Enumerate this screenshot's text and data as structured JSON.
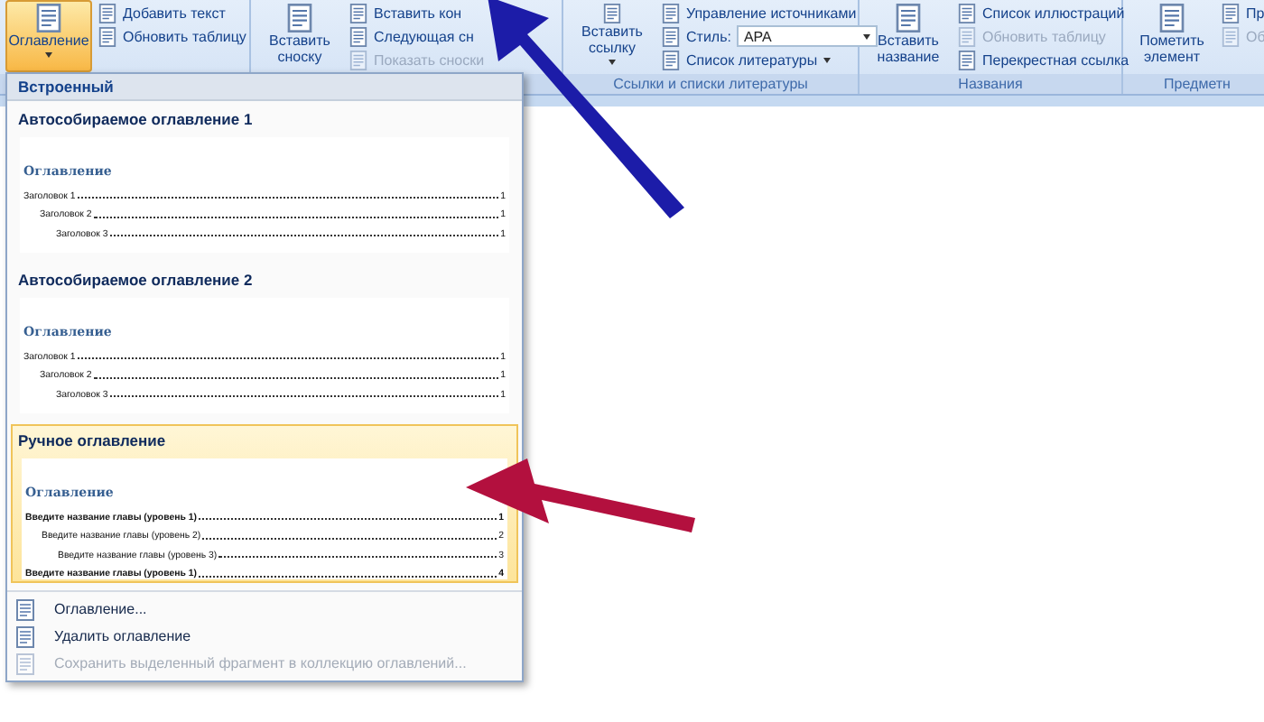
{
  "ribbon": {
    "groups": [
      {
        "large": [
          {
            "label": "Оглавление",
            "selected": true,
            "has_menu": true
          }
        ],
        "small": [
          {
            "kind": "button",
            "label": "Добавить текст",
            "disabled": false,
            "has_menu": false
          },
          {
            "kind": "button",
            "label": "Обновить таблицу",
            "disabled": false,
            "has_menu": false
          }
        ]
      },
      {
        "large": [
          {
            "label": "Вставить сноску",
            "selected": false,
            "has_menu": false
          }
        ],
        "small": [
          {
            "kind": "button",
            "label": "Вставить кон",
            "disabled": false,
            "has_menu": false
          },
          {
            "kind": "button",
            "label": "Следующая сн",
            "disabled": false,
            "has_menu": false
          },
          {
            "kind": "button",
            "label": "Показать сноски",
            "disabled": true,
            "has_menu": false
          }
        ]
      },
      {
        "label": "Ссылки и списки литературы",
        "large": [
          {
            "label": "Вставить ссылку",
            "selected": false,
            "has_menu": true
          }
        ],
        "small": [
          {
            "kind": "button",
            "label": "Управление источниками",
            "disabled": false,
            "has_menu": false
          },
          {
            "kind": "combo",
            "label": "Стиль:",
            "value": "APA"
          },
          {
            "kind": "button",
            "label": "Список литературы",
            "disabled": false,
            "has_menu": true
          }
        ]
      },
      {
        "label": "Названия",
        "large": [
          {
            "label": "Вставить название",
            "selected": false,
            "has_menu": false
          }
        ],
        "small": [
          {
            "kind": "button",
            "label": "Список иллюстраций",
            "disabled": false,
            "has_menu": false
          },
          {
            "kind": "button",
            "label": "Обновить таблицу",
            "disabled": true,
            "has_menu": false
          },
          {
            "kind": "button",
            "label": "Перекрестная ссылка",
            "disabled": false,
            "has_menu": false
          }
        ]
      },
      {
        "label": "Предметн",
        "large": [
          {
            "label": "Пометить элемент",
            "selected": false,
            "has_menu": false
          }
        ],
        "small": [
          {
            "kind": "button",
            "label": "Пр",
            "disabled": false
          },
          {
            "kind": "button",
            "label": "Об",
            "disabled": true
          }
        ]
      }
    ]
  },
  "toc_menu": {
    "header": "Встроенный",
    "items": [
      {
        "title": "Автособираемое оглавление 1",
        "selected": false,
        "heading": "Оглавление",
        "entries": [
          {
            "text": "Заголовок 1",
            "page": "1",
            "bold": false,
            "children": [
              {
                "text": "Заголовок 2",
                "page": "1",
                "bold": false,
                "children": [
                  {
                    "text": "Заголовок 3",
                    "page": "1",
                    "bold": false
                  }
                ]
              }
            ]
          }
        ]
      },
      {
        "title": "Автособираемое оглавление 2",
        "selected": false,
        "heading": "Оглавление",
        "entries": [
          {
            "text": "Заголовок 1",
            "page": "1",
            "bold": false,
            "children": [
              {
                "text": "Заголовок 2",
                "page": "1",
                "bold": false,
                "children": [
                  {
                    "text": "Заголовок 3",
                    "page": "1",
                    "bold": false
                  }
                ]
              }
            ]
          }
        ]
      },
      {
        "title": "Ручное оглавление",
        "selected": true,
        "heading": "Оглавление",
        "entries": [
          {
            "text": "Введите название главы (уровень 1)",
            "page": "1",
            "bold": true,
            "children": [
              {
                "text": "Введите название главы (уровень 2)",
                "page": "2",
                "bold": false,
                "children": [
                  {
                    "text": "Введите название главы (уровень 3)",
                    "page": "3",
                    "bold": false
                  }
                ]
              }
            ]
          },
          {
            "text": "Введите название главы (уровень 1)",
            "page": "4",
            "bold": true
          }
        ]
      }
    ],
    "commands": [
      {
        "label": "Оглавление...",
        "disabled": false
      },
      {
        "label": "Удалить оглавление",
        "disabled": false
      },
      {
        "label": "Сохранить выделенный фрагмент в коллекцию оглавлений...",
        "disabled": true
      }
    ]
  }
}
